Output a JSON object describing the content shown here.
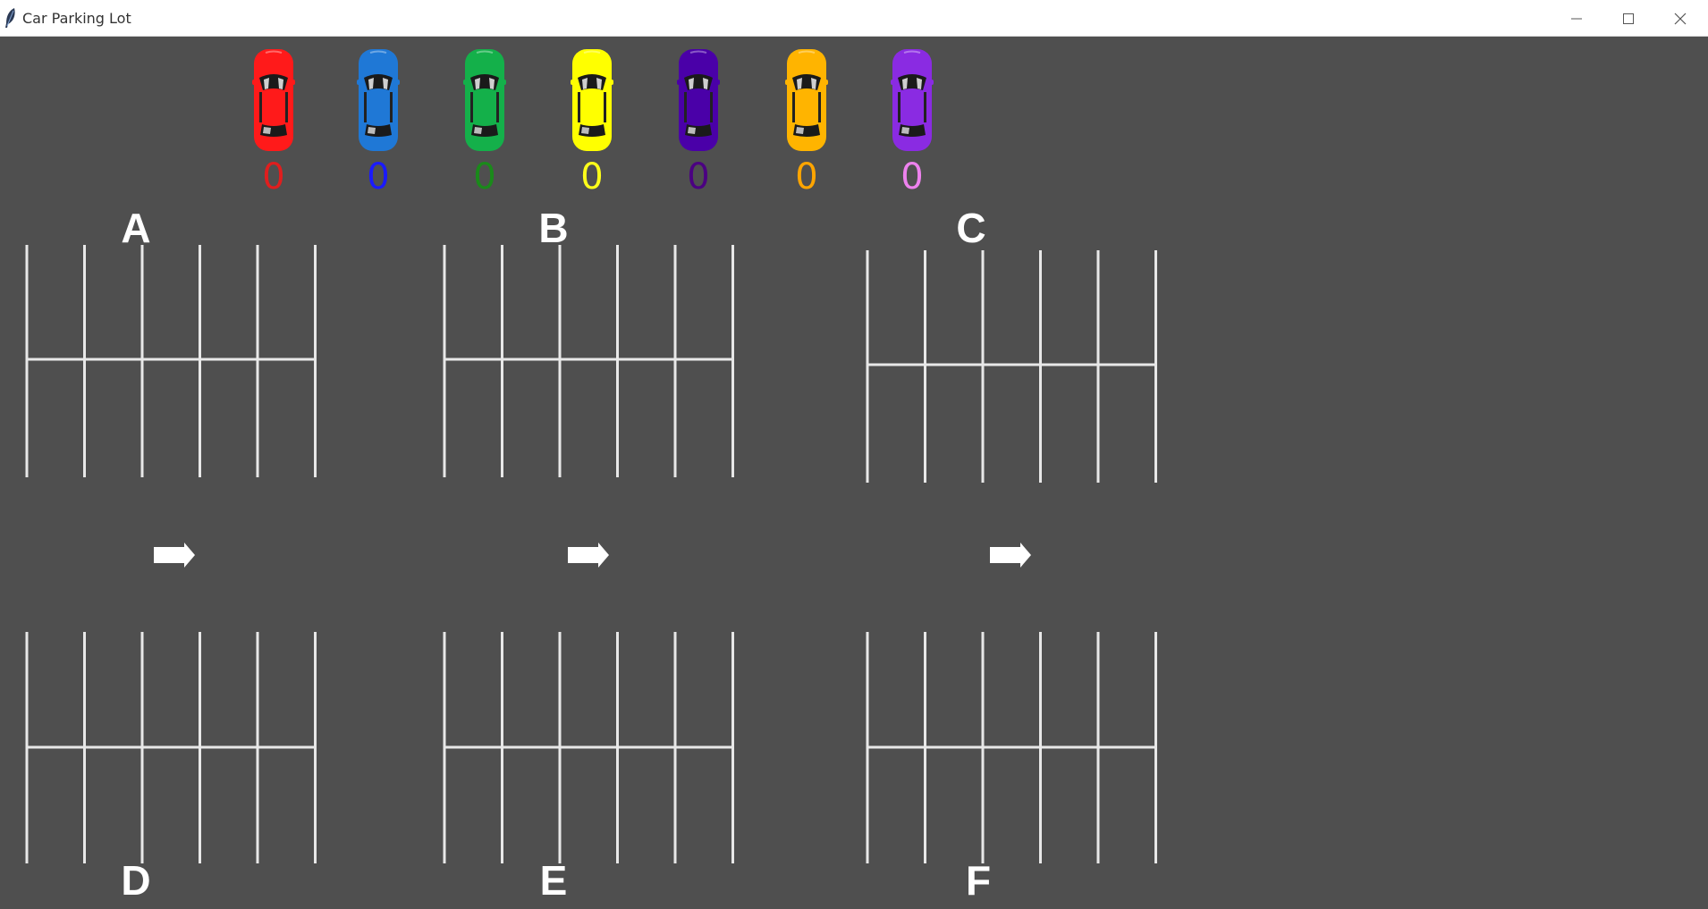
{
  "window": {
    "title": "Car Parking Lot",
    "icon": "feather-icon",
    "controls": [
      "minimize-icon",
      "maximize-icon",
      "close-icon"
    ]
  },
  "cars": [
    {
      "color": "red",
      "body": "#ff1a1a",
      "count": "0",
      "count_color": "#e01e1e"
    },
    {
      "color": "blue",
      "body": "#1f78d6",
      "count": "0",
      "count_color": "#1a1aff"
    },
    {
      "color": "green",
      "body": "#14b04a",
      "count": "0",
      "count_color": "#1a8a1a"
    },
    {
      "color": "yellow",
      "body": "#ffff00",
      "count": "0",
      "count_color": "#ffff1a"
    },
    {
      "color": "indigo",
      "body": "#4a00a8",
      "count": "0",
      "count_color": "#4b0082"
    },
    {
      "color": "orange",
      "body": "#ffb400",
      "count": "0",
      "count_color": "#ffa500"
    },
    {
      "color": "violet",
      "body": "#8a2be2",
      "count": "0",
      "count_color": "#ee82ee"
    }
  ],
  "lots": [
    {
      "id": "A"
    },
    {
      "id": "B"
    },
    {
      "id": "C"
    },
    {
      "id": "D"
    },
    {
      "id": "E"
    },
    {
      "id": "F"
    }
  ],
  "line_color": "#e8e8e8",
  "background": "#4f4f4f"
}
